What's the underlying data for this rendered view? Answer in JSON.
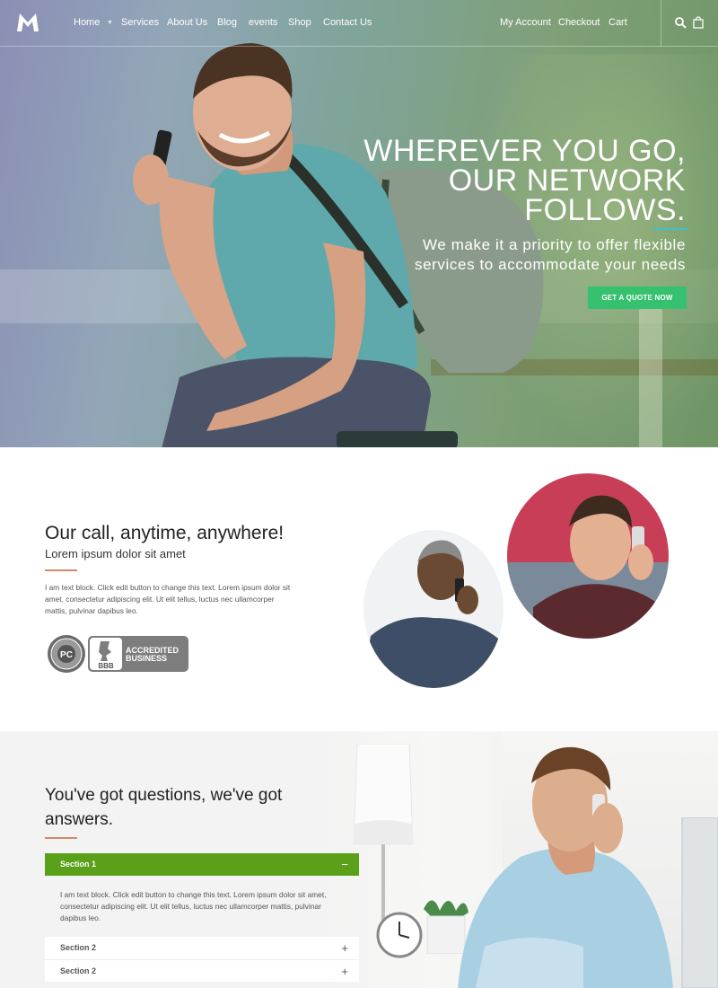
{
  "nav": {
    "left": [
      "Home",
      "Services",
      "About Us",
      "Blog",
      "events",
      "Shop",
      "Contact Us"
    ],
    "right": [
      "My Account",
      "Checkout",
      "Cart"
    ]
  },
  "hero": {
    "title_lines": [
      "WHEREVER YOU GO,",
      "OUR NETWORK",
      "FOLLOWS."
    ],
    "subtitle_lines": [
      "We make it a priority to offer flexible",
      "services to accommodate your needs"
    ],
    "cta": "GET A QUOTE NOW"
  },
  "call_section": {
    "title": "Our call, anytime, anywhere!",
    "subtitle": "Lorem ipsum dolor sit amet",
    "text": "I am text block. Click edit button to change this text. Lorem ipsum dolor sit amet, consectetur adipiscing elit. Ut elit tellus, luctus nec ullamcorper mattis, pulvinar dapibus leo.",
    "badge_accredited": "ACCREDITED",
    "badge_business": "BUSINESS",
    "badge_bbb": "BBB"
  },
  "faq": {
    "title": "You've got questions, we've got answers.",
    "sections": [
      {
        "label": "Section 1",
        "open": true,
        "sign": "−"
      },
      {
        "label": "Section 2",
        "open": false,
        "sign": "+"
      },
      {
        "label": "Section 2",
        "open": false,
        "sign": "+"
      }
    ],
    "body": "I am text block. Click edit button to change this text. Lorem ipsum dolor sit amet, consectetur adipiscing elit. Ut elit tellus, luctus nec ullamcorper mattis, pulvinar dapibus leo."
  },
  "colors": {
    "accent_green": "#35c16e",
    "accordion_green": "#5aa019",
    "rule_accent": "#d08a6a",
    "hero_accent": "#3fc1c9"
  },
  "icons": [
    "logo-m-icon",
    "search-icon",
    "shopping-bag-icon",
    "caret-down-icon"
  ]
}
